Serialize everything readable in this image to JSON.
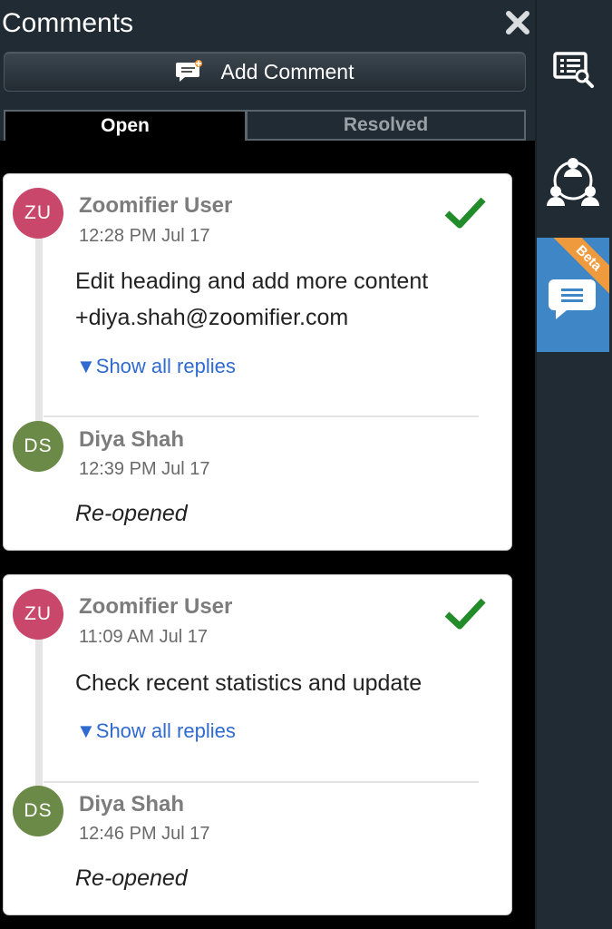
{
  "panel": {
    "title": "Comments",
    "add_comment_label": "Add Comment"
  },
  "tabs": [
    {
      "label": "Open",
      "active": true
    },
    {
      "label": "Resolved",
      "active": false
    }
  ],
  "comments": [
    {
      "initials": "ZU",
      "author": "Zoomifier User",
      "time": "12:28 PM Jul 17",
      "text_line1": "Edit heading and add more content",
      "text_line2": "+diya.shah@zoomifier.com",
      "show_replies": "▼Show all replies",
      "reply": {
        "initials": "DS",
        "author": "Diya Shah",
        "time": "12:39 PM Jul 17",
        "text": "Re-opened"
      }
    },
    {
      "initials": "ZU",
      "author": "Zoomifier User",
      "time": "11:09 AM Jul 17",
      "text_line1": "Check recent statistics and update",
      "show_replies": "▼Show all replies",
      "reply": {
        "initials": "DS",
        "author": "Diya Shah",
        "time": "12:46 PM Jul 17",
        "text": "Re-opened"
      }
    }
  ],
  "sidebar": {
    "beta_label": "Beta",
    "items": [
      {
        "icon": "review-list-icon"
      },
      {
        "icon": "collaborators-icon"
      },
      {
        "icon": "comments-icon",
        "active": true
      }
    ]
  },
  "colors": {
    "panel_bg": "#212b33",
    "accent_blue": "#3e86c6",
    "beta_orange": "#f09a3e",
    "check_green": "#238c2a",
    "link_blue": "#2f6ad0",
    "avatar_zu": "#c8476a",
    "avatar_ds": "#6b8a48"
  }
}
